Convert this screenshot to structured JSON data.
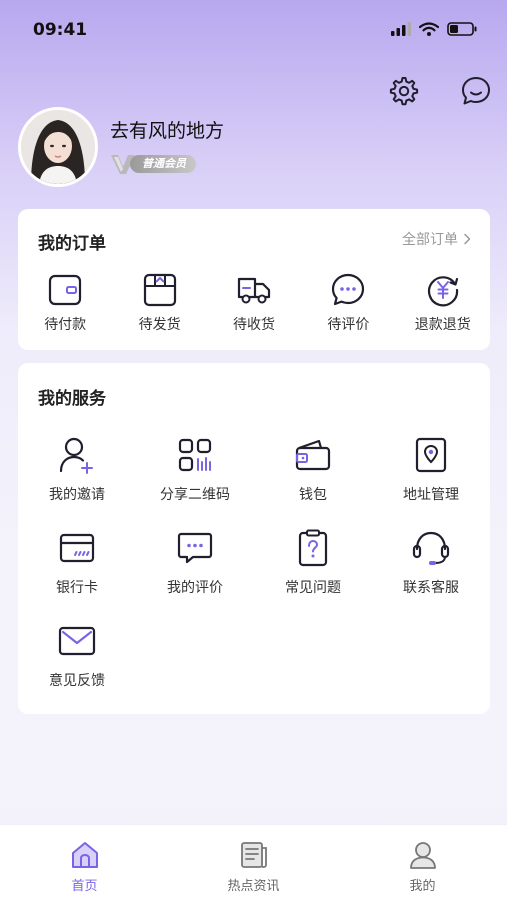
{
  "status_bar": {
    "time": "09:41"
  },
  "profile": {
    "username": "去有风的地方",
    "member_level": "普通会员"
  },
  "orders": {
    "title": "我的订单",
    "all_link": "全部订单",
    "items": [
      {
        "label": "待付款",
        "icon": "wallet-icon"
      },
      {
        "label": "待发货",
        "icon": "box-icon"
      },
      {
        "label": "待收货",
        "icon": "truck-icon"
      },
      {
        "label": "待评价",
        "icon": "chat-bubble-icon"
      },
      {
        "label": "退款退货",
        "icon": "yen-refund-icon"
      }
    ]
  },
  "services": {
    "title": "我的服务",
    "items": [
      {
        "label": "我的邀请",
        "icon": "user-add-icon"
      },
      {
        "label": "分享二维码",
        "icon": "qr-code-icon"
      },
      {
        "label": "钱包",
        "icon": "wallet-icon"
      },
      {
        "label": "地址管理",
        "icon": "location-icon"
      },
      {
        "label": "银行卡",
        "icon": "bank-card-icon"
      },
      {
        "label": "我的评价",
        "icon": "comment-icon"
      },
      {
        "label": "常见问题",
        "icon": "question-icon"
      },
      {
        "label": "联系客服",
        "icon": "headset-icon"
      },
      {
        "label": "意见反馈",
        "icon": "mail-icon"
      }
    ]
  },
  "tabs": [
    {
      "label": "首页",
      "icon": "home-icon",
      "active": true
    },
    {
      "label": "热点资讯",
      "icon": "news-icon",
      "active": false
    },
    {
      "label": "我的",
      "icon": "user-icon",
      "active": false
    }
  ],
  "colors": {
    "accent": "#7b63e6",
    "icon_stroke": "#1f1f2e"
  }
}
